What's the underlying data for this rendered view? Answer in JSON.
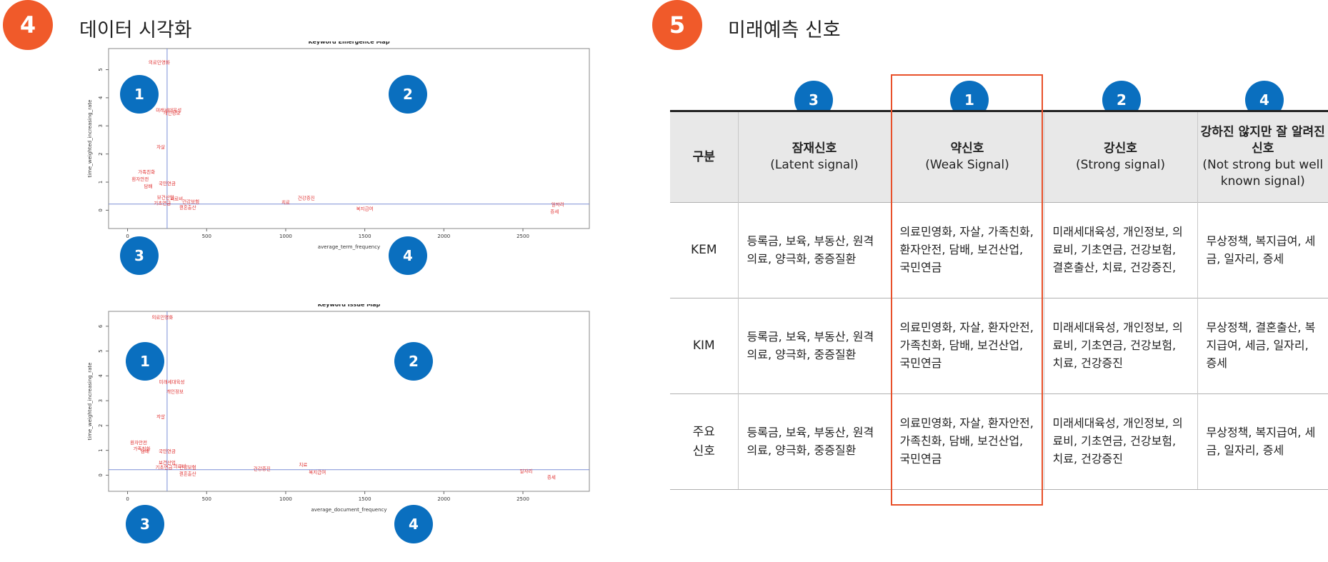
{
  "section4": {
    "number": "4",
    "title": "데이터 시각화"
  },
  "section5": {
    "number": "5",
    "title": "미래예측 신호"
  },
  "charts": [
    {
      "title": "Keyword Emergence Map",
      "xlabel": "average_term_frequency",
      "ylabel": "time_weighted_increasing_rate",
      "xticks": [
        "0",
        "500",
        "1000",
        "1500",
        "2000",
        "2500"
      ],
      "yticks": [
        "0",
        "1",
        "2",
        "3",
        "4",
        "5"
      ],
      "quadrants": [
        "1",
        "2",
        "3",
        "4"
      ]
    },
    {
      "title": "Keyword Issue Map",
      "xlabel": "average_document_frequency",
      "ylabel": "time_weighted_increasing_rate",
      "xticks": [
        "0",
        "500",
        "1000",
        "1500",
        "2000",
        "2500"
      ],
      "yticks": [
        "0",
        "1",
        "2",
        "3",
        "4",
        "5",
        "6"
      ],
      "quadrants": [
        "1",
        "2",
        "3",
        "4"
      ]
    }
  ],
  "chart_data": [
    {
      "type": "scatter",
      "title": "Keyword Emergence Map",
      "xlabel": "average_term_frequency",
      "ylabel": "time_weighted_increasing_rate",
      "xlim": [
        -120,
        2920
      ],
      "ylim": [
        -0.65,
        5.75
      ],
      "reference_lines": {
        "x": 250,
        "y": 0.22
      },
      "grid": false,
      "points": [
        {
          "x": 200,
          "y": 5.2,
          "label": "의료민영화"
        },
        {
          "x": 260,
          "y": 3.5,
          "label": "미래세대육성"
        },
        {
          "x": 280,
          "y": 3.4,
          "label": "개인정보"
        },
        {
          "x": 210,
          "y": 2.2,
          "label": "자살"
        },
        {
          "x": 120,
          "y": 1.3,
          "label": "가족친화"
        },
        {
          "x": 80,
          "y": 1.05,
          "label": "환자안전"
        },
        {
          "x": 130,
          "y": 0.8,
          "label": "담배"
        },
        {
          "x": 250,
          "y": 0.9,
          "label": "국민연금"
        },
        {
          "x": 240,
          "y": 0.4,
          "label": "보건산업"
        },
        {
          "x": 310,
          "y": 0.35,
          "label": "의료비"
        },
        {
          "x": 220,
          "y": 0.2,
          "label": "기초연금"
        },
        {
          "x": 400,
          "y": 0.25,
          "label": "건강보험"
        },
        {
          "x": 380,
          "y": 0.05,
          "label": "결혼출산"
        },
        {
          "x": 1000,
          "y": 0.22,
          "label": "치료"
        },
        {
          "x": 1130,
          "y": 0.38,
          "label": "건강증진"
        },
        {
          "x": 1500,
          "y": 0.0,
          "label": "복지급여"
        },
        {
          "x": 2720,
          "y": 0.15,
          "label": "일자리"
        },
        {
          "x": 2700,
          "y": -0.1,
          "label": "증세"
        }
      ]
    },
    {
      "type": "scatter",
      "title": "Keyword Issue Map",
      "xlabel": "average_document_frequency",
      "ylabel": "time_weighted_increasing_rate",
      "xlim": [
        -120,
        2920
      ],
      "ylim": [
        -0.65,
        6.6
      ],
      "reference_lines": {
        "x": 250,
        "y": 0.22
      },
      "grid": false,
      "points": [
        {
          "x": 220,
          "y": 6.3,
          "label": "의료민영화"
        },
        {
          "x": 280,
          "y": 3.7,
          "label": "미래세대육성"
        },
        {
          "x": 300,
          "y": 3.3,
          "label": "개인정보"
        },
        {
          "x": 210,
          "y": 2.3,
          "label": "자살"
        },
        {
          "x": 70,
          "y": 1.25,
          "label": "환자안전"
        },
        {
          "x": 90,
          "y": 1.0,
          "label": "가족친화"
        },
        {
          "x": 110,
          "y": 0.9,
          "label": "담배"
        },
        {
          "x": 250,
          "y": 0.9,
          "label": "국민연금"
        },
        {
          "x": 250,
          "y": 0.45,
          "label": "보건산업"
        },
        {
          "x": 330,
          "y": 0.3,
          "label": "의료비"
        },
        {
          "x": 230,
          "y": 0.25,
          "label": "기초연금"
        },
        {
          "x": 380,
          "y": 0.25,
          "label": "건강보험"
        },
        {
          "x": 380,
          "y": 0.0,
          "label": "결혼출산"
        },
        {
          "x": 850,
          "y": 0.2,
          "label": "건강증진"
        },
        {
          "x": 1110,
          "y": 0.35,
          "label": "치료"
        },
        {
          "x": 1200,
          "y": 0.05,
          "label": "복지급여"
        },
        {
          "x": 2520,
          "y": 0.1,
          "label": "일자리"
        },
        {
          "x": 2680,
          "y": -0.15,
          "label": "증세"
        }
      ]
    }
  ],
  "table": {
    "header": {
      "corner": "구분",
      "cols": [
        {
          "num": "3",
          "title": "잠재신호",
          "sub": "(Latent signal)"
        },
        {
          "num": "1",
          "title": "약신호",
          "sub": "(Weak Signal)"
        },
        {
          "num": "2",
          "title": "강신호",
          "sub": "(Strong signal)"
        },
        {
          "num": "4",
          "title": "강하진 않지만 잘 알려진 신호",
          "sub": "(Not strong but well known signal)"
        }
      ]
    },
    "rows": [
      {
        "label": "KEM",
        "cells": [
          "등록금, 보육, 부동산, 원격의료, 양극화, 중증질환",
          "의료민영화, 자살, 가족친화, 환자안전, 담배, 보건산업, 국민연금",
          "미래세대육성, 개인정보, 의료비, 기초연금, 건강보험, 결혼출산, 치료, 건강증진,",
          "무상정책, 복지급여, 세금, 일자리, 증세"
        ]
      },
      {
        "label": "KIM",
        "cells": [
          "등록금, 보육, 부동산, 원격의료, 양극화, 중증질환",
          "의료민영화, 자살, 환자안전, 가족친화, 담배, 보건산업, 국민연금",
          "미래세대육성, 개인정보, 의료비, 기초연금, 건강보험, 치료, 건강증진",
          "무상정책, 결혼출산, 복지급여, 세금, 일자리, 증세"
        ]
      },
      {
        "label": "주요 신호",
        "cells": [
          "등록금, 보육, 부동산, 원격의료, 양극화, 중증질환",
          "의료민영화, 자살, 환자안전, 가족친화, 담배, 보건산업, 국민연금",
          "미래세대육성, 개인정보, 의료비, 기초연금, 건강보험, 치료, 건강증진",
          "무상정책, 복지급여, 세금, 일자리, 증세"
        ]
      }
    ]
  }
}
